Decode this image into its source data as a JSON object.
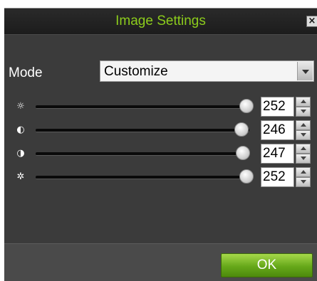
{
  "dialog": {
    "title": "Image Settings",
    "close_icon": "close-icon",
    "colors": {
      "title": "#8ccc1c",
      "background": "#3b3b3b",
      "ok_button": "#66a81a"
    }
  },
  "mode": {
    "label": "Mode",
    "value": "Customize"
  },
  "sliders": [
    {
      "icon": "brightness-icon",
      "value": "252",
      "max": 255
    },
    {
      "icon": "contrast-icon",
      "value": "246",
      "max": 255
    },
    {
      "icon": "saturation-icon",
      "value": "247",
      "max": 255
    },
    {
      "icon": "hue-icon",
      "value": "252",
      "max": 255
    }
  ],
  "footer": {
    "ok_label": "OK"
  }
}
